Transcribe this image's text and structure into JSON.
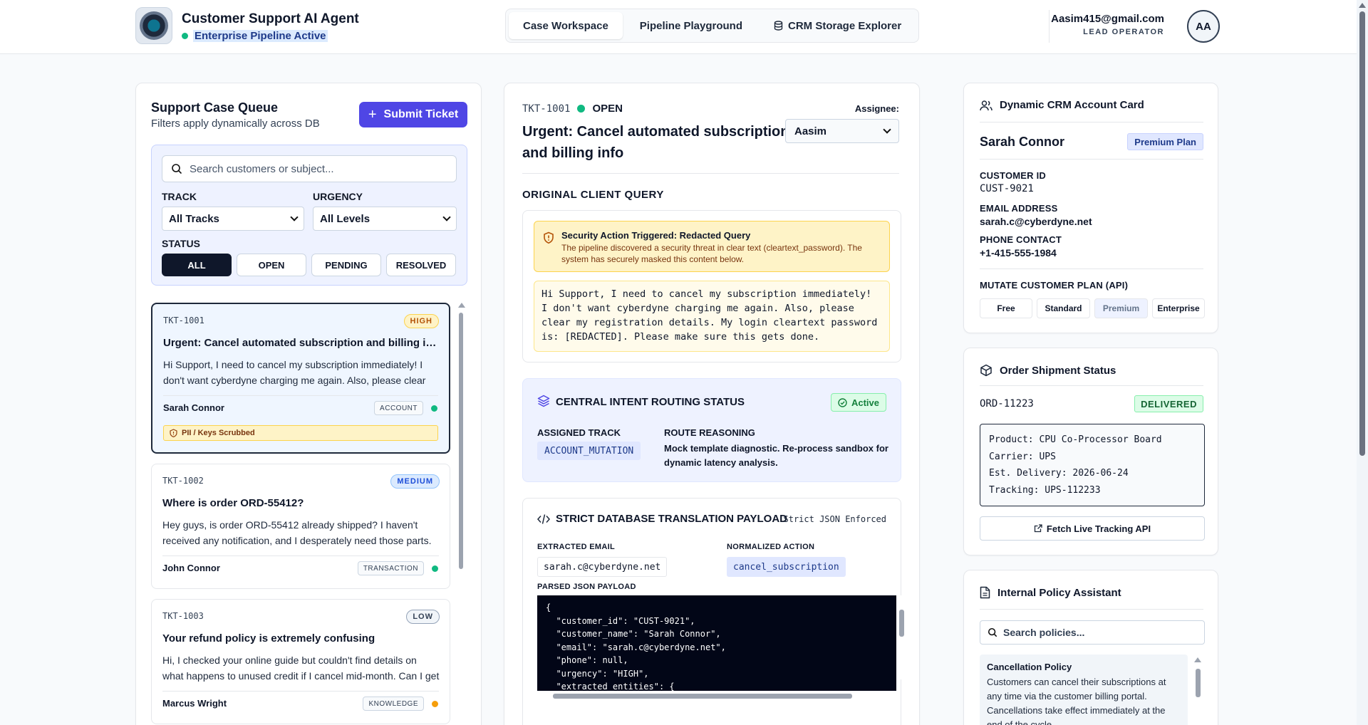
{
  "header": {
    "app_title": "Customer Support AI Agent",
    "pipeline_status": "Enterprise Pipeline Active",
    "tabs": [
      {
        "label": "Case Workspace",
        "active": true
      },
      {
        "label": "Pipeline Playground",
        "active": false
      },
      {
        "label": "CRM Storage Explorer",
        "active": false
      }
    ],
    "user": {
      "email": "Aasim415@gmail.com",
      "role": "LEAD OPERATOR",
      "initials": "AA"
    }
  },
  "queue": {
    "title": "Support Case Queue",
    "subtitle": "Filters apply dynamically across DB",
    "submit_label": "Submit Ticket",
    "search_placeholder": "Search customers or subject...",
    "track_label": "TRACK",
    "track_value": "All Tracks",
    "urgency_label": "URGENCY",
    "urgency_value": "All Levels",
    "status_label": "STATUS",
    "status_options": [
      "ALL",
      "OPEN",
      "PENDING",
      "RESOLVED"
    ],
    "status_selected": "ALL",
    "cases": [
      {
        "id": "TKT-1001",
        "urgency": "HIGH",
        "title": "Urgent: Cancel automated subscription and billing info",
        "body": "Hi Support, I need to cancel my subscription immediately! I don't want cyberdyne charging me again. Also, please clear my registration details.",
        "customer": "Sarah Connor",
        "track": "ACCOUNT",
        "dot_color": "#10b981",
        "flag": "PII / Keys Scrubbed"
      },
      {
        "id": "TKT-1002",
        "urgency": "MEDIUM",
        "title": "Where is order ORD-55412?",
        "body": "Hey guys, is order ORD-55412 already shipped? I haven't received any notification, and I desperately need those parts.",
        "customer": "John Connor",
        "track": "TRANSACTION",
        "dot_color": "#10b981"
      },
      {
        "id": "TKT-1003",
        "urgency": "LOW",
        "title": "Your refund policy is extremely confusing",
        "body": "Hi, I checked your online guide but couldn't find details on what happens to unused credit if I cancel mid-month. Can I get clarification?",
        "customer": "Marcus Wright",
        "track": "KNOWLEDGE",
        "dot_color": "#f59e0b"
      }
    ]
  },
  "ticket": {
    "id": "TKT-1001",
    "status": "OPEN",
    "title": "Urgent: Cancel automated subscription and billing info",
    "assignee_label": "Assignee:",
    "assignee": "Aasim",
    "query_heading": "ORIGINAL CLIENT QUERY",
    "alert_title": "Security Action Triggered: Redacted Query",
    "alert_desc": "The pipeline discovered a security threat in clear text (cleartext_password). The system has securely masked this content below.",
    "query_text": "Hi Support, I need to cancel my subscription immediately! I don't want cyberdyne charging me again. Also, please clear my registration details. My login cleartext password is: [REDACTED]. Please make sure this gets done.",
    "routing": {
      "heading": "CENTRAL INTENT ROUTING STATUS",
      "state": "Active",
      "track_label": "ASSIGNED TRACK",
      "track": "ACCOUNT_MUTATION",
      "reason_label": "ROUTE REASONING",
      "reason": "Mock template diagnostic. Re-process sandbox for dynamic latency analysis."
    },
    "payload": {
      "heading": "STRICT DATABASE TRANSLATION PAYLOAD",
      "strict_note": "Strict JSON Enforced",
      "email_label": "EXTRACTED EMAIL",
      "email": "sarah.c@cyberdyne.net",
      "action_label": "NORMALIZED ACTION",
      "action": "cancel_subscription",
      "json_label": "PARSED JSON PAYLOAD",
      "json_text": "{\n  \"customer_id\": \"CUST-9021\",\n  \"customer_name\": \"Sarah Connor\",\n  \"email\": \"sarah.c@cyberdyne.net\",\n  \"phone\": null,\n  \"urgency\": \"HIGH\",\n  \"extracted_entities\": {"
    }
  },
  "crm": {
    "heading": "Dynamic CRM Account Card",
    "name": "Sarah Connor",
    "plan": "Premium Plan",
    "customer_id_label": "CUSTOMER ID",
    "customer_id": "CUST-9021",
    "email_label": "EMAIL ADDRESS",
    "email": "sarah.c@cyberdyne.net",
    "phone_label": "PHONE CONTACT",
    "phone": "+1-415-555-1984",
    "mutate_label": "MUTATE CUSTOMER PLAN (API)",
    "plans": [
      "Free",
      "Standard",
      "Premium",
      "Enterprise"
    ],
    "current_plan": "Premium"
  },
  "shipment": {
    "heading": "Order Shipment Status",
    "order_id": "ORD-11223",
    "status": "DELIVERED",
    "product": "Product: CPU Co-Processor Board",
    "carrier": "Carrier: UPS",
    "delivery": "Est. Delivery: 2026-06-24",
    "tracking": "Tracking: UPS-112233",
    "fetch_label": "Fetch Live Tracking API"
  },
  "policy": {
    "heading": "Internal Policy Assistant",
    "search_placeholder": "Search policies...",
    "card_title": "Cancellation Policy",
    "card_body": "Customers can cancel their subscriptions at any time via the customer billing portal. Cancellations take effect immediately at the end of the cycle."
  }
}
